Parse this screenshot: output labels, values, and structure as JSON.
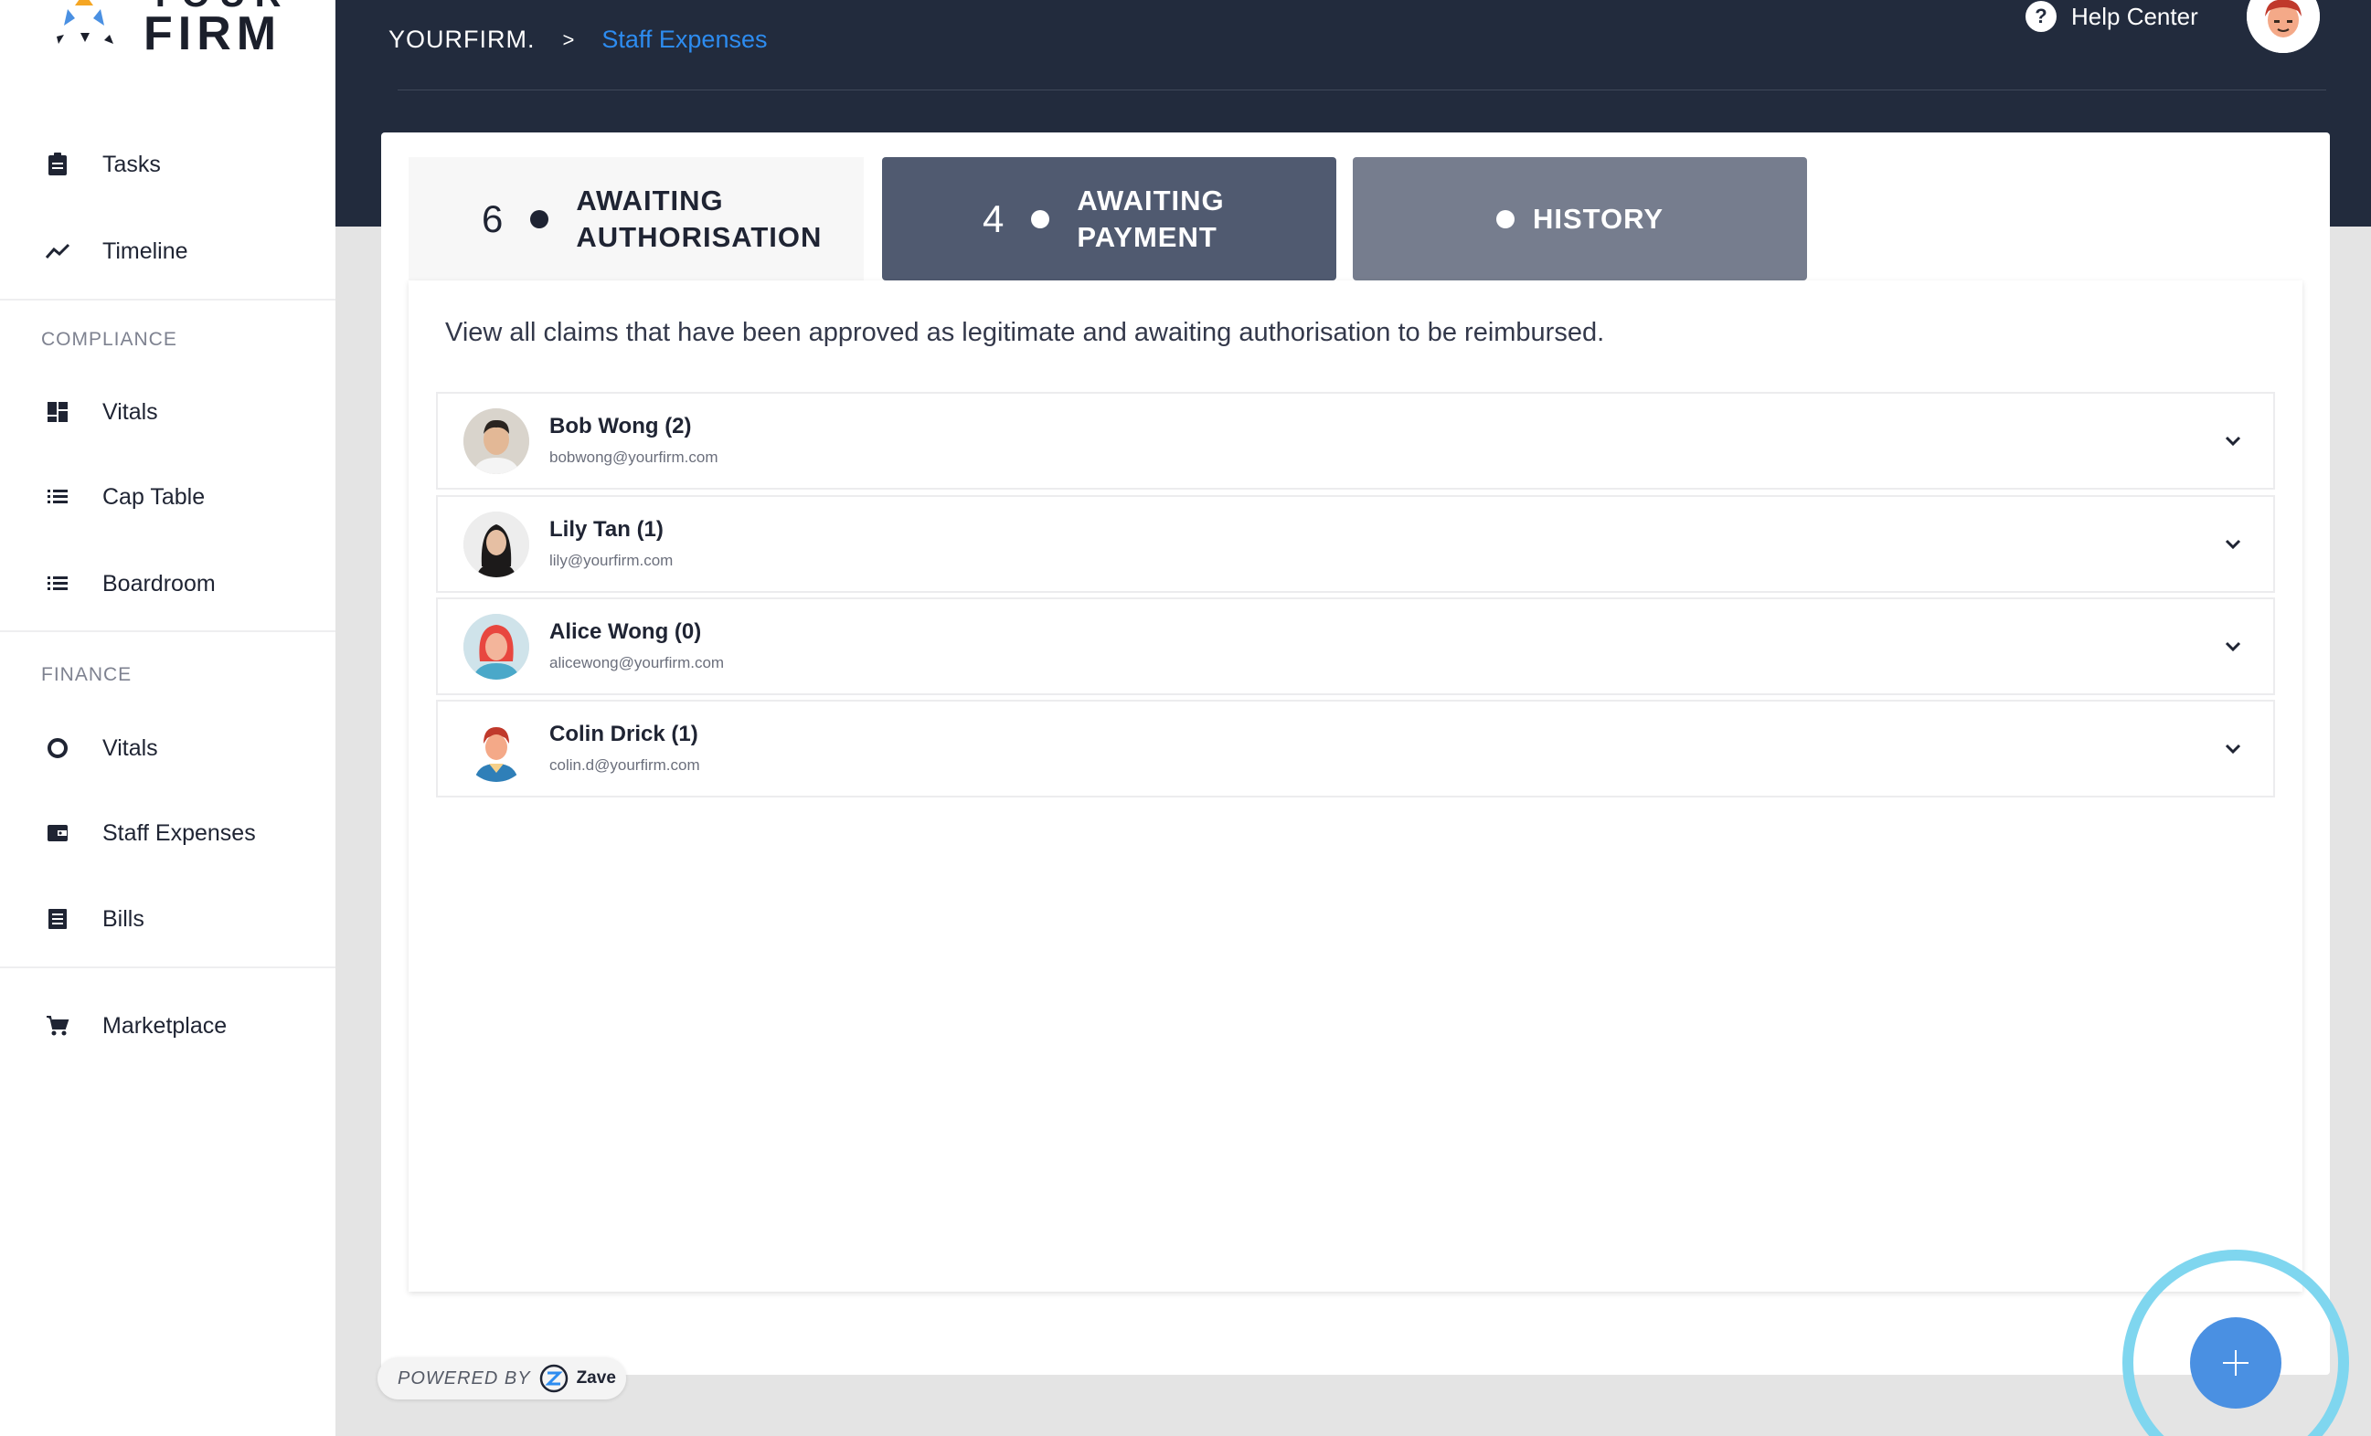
{
  "brand": {
    "name": "FIRM",
    "top_word": "YOUR"
  },
  "sidebar": {
    "top_items": [
      {
        "label": "Tasks",
        "icon": "clipboard-icon"
      },
      {
        "label": "Timeline",
        "icon": "trend-icon"
      }
    ],
    "compliance": {
      "title": "COMPLIANCE",
      "items": [
        {
          "label": "Vitals",
          "icon": "dashboard-icon"
        },
        {
          "label": "Cap Table",
          "icon": "list-icon"
        },
        {
          "label": "Boardroom",
          "icon": "list-icon"
        }
      ]
    },
    "finance": {
      "title": "FINANCE",
      "items": [
        {
          "label": "Vitals",
          "icon": "donut-icon"
        },
        {
          "label": "Staff Expenses",
          "icon": "wallet-icon"
        },
        {
          "label": "Bills",
          "icon": "document-icon"
        }
      ]
    },
    "bottom_items": [
      {
        "label": "Marketplace",
        "icon": "cart-icon"
      }
    ]
  },
  "header": {
    "breadcrumb_root": "YOURFIRM.",
    "breadcrumb_separator": ">",
    "breadcrumb_current": "Staff Expenses",
    "help_label": "Help Center"
  },
  "tabs": {
    "authorisation": {
      "count": "6",
      "label": "AWAITING\nAUTHORISATION"
    },
    "payment": {
      "count": "4",
      "label": "AWAITING\nPAYMENT"
    },
    "history": {
      "label": "HISTORY"
    }
  },
  "description": "View all claims that have been approved as legitimate and awaiting authorisation to be reimbursed.",
  "claims": [
    {
      "name": "Bob Wong (2)",
      "email": "bobwong@yourfirm.com"
    },
    {
      "name": "Lily Tan (1)",
      "email": "lily@yourfirm.com"
    },
    {
      "name": "Alice Wong (0)",
      "email": "alicewong@yourfirm.com"
    },
    {
      "name": "Colin Drick (1)",
      "email": "colin.d@yourfirm.com"
    }
  ],
  "footer": {
    "powered_by": "POWERED BY",
    "provider": "Zave"
  },
  "colors": {
    "navy": "#222b3d",
    "accent": "#2d8cf0",
    "fab": "#4a90e2",
    "fab_ring": "#7fd6ef"
  }
}
